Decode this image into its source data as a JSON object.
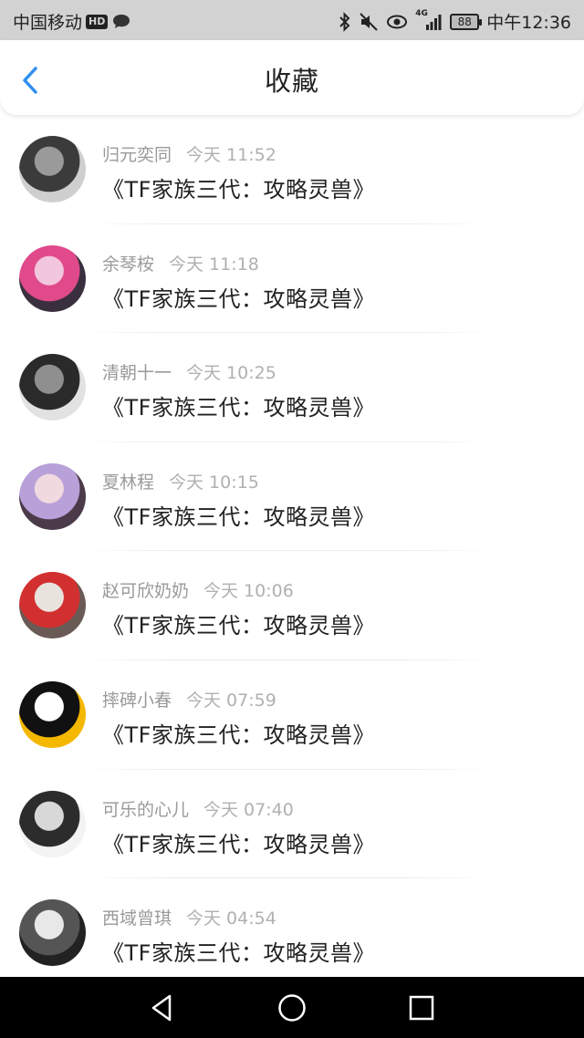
{
  "status_bar": {
    "carrier": "中国移动",
    "hd": "HD",
    "network": "4G",
    "battery": "88",
    "time": "中午12:36"
  },
  "header": {
    "title": "收藏",
    "back_icon": "chevron-left-icon"
  },
  "items": [
    {
      "name": "归元奕同",
      "time": "今天 11:52",
      "title": "《TF家族三代：攻略灵兽》",
      "avatar_colors": [
        "#3b3b3b",
        "#9a9a9a",
        "#cfcfcf"
      ]
    },
    {
      "name": "余琴桉",
      "time": "今天 11:18",
      "title": "《TF家族三代：攻略灵兽》",
      "avatar_colors": [
        "#e04a8a",
        "#f2c6dc",
        "#3a2f3f"
      ]
    },
    {
      "name": "清朝十一",
      "time": "今天 10:25",
      "title": "《TF家族三代：攻略灵兽》",
      "avatar_colors": [
        "#2a2a2a",
        "#8f8f8f",
        "#e2e2e2"
      ]
    },
    {
      "name": "夏林程",
      "time": "今天 10:15",
      "title": "《TF家族三代：攻略灵兽》",
      "avatar_colors": [
        "#b8a0d8",
        "#f1d9e0",
        "#4a3a4a"
      ]
    },
    {
      "name": "赵可欣奶奶",
      "time": "今天 10:06",
      "title": "《TF家族三代：攻略灵兽》",
      "avatar_colors": [
        "#d23030",
        "#e9e3de",
        "#6a5a55"
      ]
    },
    {
      "name": "摔碑小春",
      "time": "今天 07:59",
      "title": "《TF家族三代：攻略灵兽》",
      "avatar_colors": [
        "#111111",
        "#ffffff",
        "#f5b800"
      ]
    },
    {
      "name": "可乐的心儿",
      "time": "今天 07:40",
      "title": "《TF家族三代：攻略灵兽》",
      "avatar_colors": [
        "#2c2c2c",
        "#d8d8d8",
        "#f3f3f3"
      ]
    },
    {
      "name": "西域曾琪",
      "time": "今天 04:54",
      "title": "《TF家族三代：攻略灵兽》",
      "avatar_colors": [
        "#555555",
        "#e8e8e8",
        "#222222"
      ]
    }
  ],
  "nav": {
    "back": "triangle-back-icon",
    "home": "circle-home-icon",
    "recent": "square-recent-icon"
  },
  "colors": {
    "accent": "#2f8ff0",
    "status_bg": "#d2d2d2",
    "nav_bg": "#000000"
  }
}
